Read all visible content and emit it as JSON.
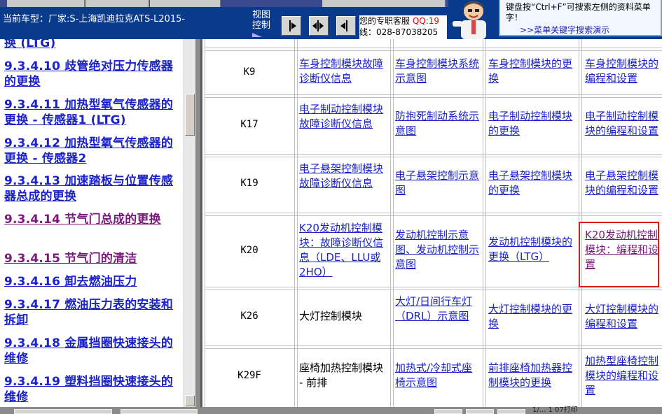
{
  "header": {
    "car_info": "当前车型：厂家:S-上海凯迪拉克ATS-L2015-",
    "view_control_label": "视图控制",
    "service_text": "您的专职客服",
    "service_qq": "QQ:19",
    "service_phone": "线：028-87038205",
    "tip_text": "键盘按“Ctrl+F”可搜索左侧的资料菜单字！",
    "tip_link": ">>菜单关键字搜索演示"
  },
  "toc": [
    {
      "text": "换 (LTG)",
      "visited": false
    },
    {
      "text": "9.3.4.10 歧管绝对压力传感器的更换",
      "visited": false
    },
    {
      "text": "9.3.4.11 加热型氧气传感器的更换 - 传感器1 (LTG)",
      "visited": false
    },
    {
      "text": "9.3.4.12 加热型氧气传感器的更换 - 传感器2",
      "visited": false
    },
    {
      "text": "9.3.4.13 加速踏板与位置传感器总成的更换",
      "visited": false
    },
    {
      "text": "9.3.4.14 节气门总成的更换",
      "visited": true
    },
    {
      "text": "9.3.4.15 节气门的清洁",
      "visited": true
    },
    {
      "text": "9.3.4.16 卸去燃油压力",
      "visited": false
    },
    {
      "text": "9.3.4.17 燃油压力表的安装和拆卸",
      "visited": false
    },
    {
      "text": "9.3.4.18 金属挡圈快速接头的维修",
      "visited": false
    },
    {
      "text": "9.3.4.19 塑料挡圈快速接头的维修",
      "visited": false
    }
  ],
  "table": {
    "rows": [
      {
        "code": "K9",
        "cells": [
          {
            "text": "车身控制模块故障诊断仪信息",
            "link": true
          },
          {
            "text": "车身控制模块系统示意图",
            "link": true
          },
          {
            "text": "车身控制模块的更换",
            "link": true
          },
          {
            "text": "车身控制模块的编程和设置",
            "link": true
          }
        ]
      },
      {
        "code": "K17",
        "cells": [
          {
            "text": "电子制动控制模块故障诊断仪信息",
            "link": true
          },
          {
            "text": "防抱死制动系统示意图",
            "link": true
          },
          {
            "text": "电子制动控制模块的更换",
            "link": true
          },
          {
            "text": "电子制动控制模块的编程和设置",
            "link": true
          }
        ]
      },
      {
        "code": "K19",
        "cells": [
          {
            "text": "电子悬架控制模块故障诊断仪信息",
            "link": true
          },
          {
            "text": "电子悬架控制示意图",
            "link": true
          },
          {
            "text": "电子悬架控制模块的更换",
            "link": true
          },
          {
            "text": "电子悬架控制模块的编程和设置",
            "link": true
          }
        ]
      },
      {
        "code": "K20",
        "cells": [
          {
            "text": "K20发动机控制模块：故障诊断仪信息（LDE、LLU或2HO）",
            "link": true
          },
          {
            "text": "发动机控制示意图、发动机控制示意图",
            "link": true
          },
          {
            "text": "发动机控制模块的更换（LTG）",
            "link": true
          },
          {
            "text": "K20发动机控制模块：编程和设置",
            "link": true,
            "visited": true
          }
        ]
      },
      {
        "code": "K26",
        "cells": [
          {
            "text": "大灯控制模块",
            "link": false
          },
          {
            "text": "大灯/日间行车灯（DRL）示意图",
            "link": true
          },
          {
            "text": "大灯控制模块的更换",
            "link": true
          },
          {
            "text": "大灯控制模块的编程和设置",
            "link": true
          }
        ]
      },
      {
        "code": "K29F",
        "cells": [
          {
            "text": "座椅加热控制模块 - 前排",
            "link": false
          },
          {
            "text": "加热式/冷却式座椅示意图",
            "link": true
          },
          {
            "text": "前排座椅加热器控制模块的更换",
            "link": true
          },
          {
            "text": "加热型座椅控制模块的编程和设置",
            "link": true
          }
        ]
      }
    ]
  },
  "footer": {
    "status_text": "1/... 1 07打印"
  },
  "colors": {
    "header_bg": "#0a3a8c",
    "link": "#1a22c8",
    "visited": "#7a1a7a",
    "highlight_box": "#e01818"
  }
}
